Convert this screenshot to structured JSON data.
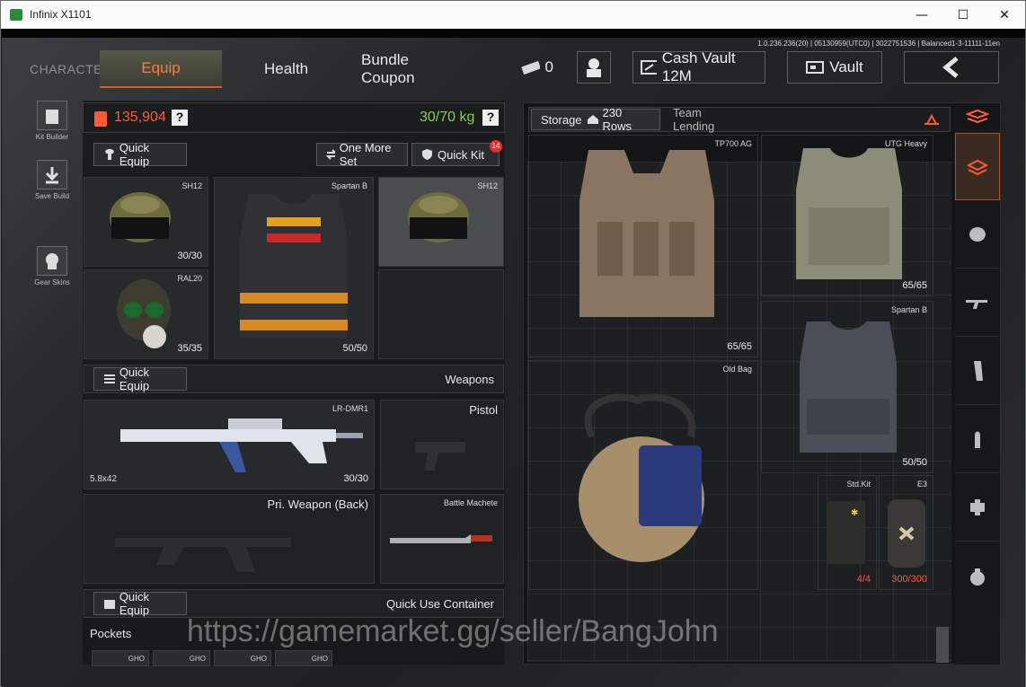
{
  "window": {
    "title": "Infinix X1101",
    "minimize": "—",
    "maximize": "☐",
    "close": "✕"
  },
  "version": "1.0.236.236(20) | 05130959(UTC0) | 3022751536 | Balanced1-3-11111-11en",
  "tabs": {
    "character": "CHARACTER",
    "equip": "Equip",
    "health": "Health",
    "bundle": "Bundle Coupon"
  },
  "topbar": {
    "money": "0",
    "cash_vault": "Cash Vault 12M",
    "vault": "Vault"
  },
  "leftbar": {
    "kit_builder": "Kit Builder",
    "save_build": "Save Build",
    "gear_skins": "Gear Skins"
  },
  "gear": {
    "value": "135,904",
    "weight": "30/70 kg",
    "help": "?"
  },
  "gear_buttons": {
    "quick_equip": "Quick Equip",
    "one_more_set": "One More Set",
    "quick_kit": "Quick Kit",
    "quick_kit_badge": "14"
  },
  "slots": {
    "helmet": {
      "name": "SH12",
      "durability": "30/30"
    },
    "mask": {
      "name": "RAL20",
      "durability": "35/35"
    },
    "vest": {
      "name": "Spartan B",
      "durability": "50/50"
    },
    "helmet_alt": {
      "name": "SH12"
    }
  },
  "weapons": {
    "quick_equip": "Quick Equip",
    "title": "Weapons",
    "primary_name": "LR-DMR1",
    "primary_ammo": "5.8x42",
    "primary_durability": "30/30",
    "pistol": "Pistol",
    "back_weapon": "Pri. Weapon (Back)",
    "melee": "Battle Machete"
  },
  "quickuse": {
    "quick_equip": "Quick Equip",
    "title": "Quick Use Container"
  },
  "pockets": {
    "title": "Pockets",
    "items": [
      "GHO",
      "GHO",
      "GHO",
      "GHO"
    ]
  },
  "storage": {
    "tab": "Storage",
    "rows": "230 Rows",
    "team_lending": "Team Lending"
  },
  "storage_items": [
    {
      "name": "TP700 AG",
      "durability": "65/65"
    },
    {
      "name": "UTG Heavy",
      "durability": "65/65"
    },
    {
      "name": "Spartan B",
      "durability": "50/50"
    },
    {
      "name": "Old Bag"
    },
    {
      "name": "Std.Kit",
      "durability": "4/4"
    },
    {
      "name": "E3",
      "durability": "300/300"
    }
  ],
  "watermark": "https://gamemarket.gg/seller/BangJohn",
  "colors": {
    "accent": "#e05a22",
    "weight_green": "#7ed63d",
    "value_red": "#ff5a33"
  }
}
